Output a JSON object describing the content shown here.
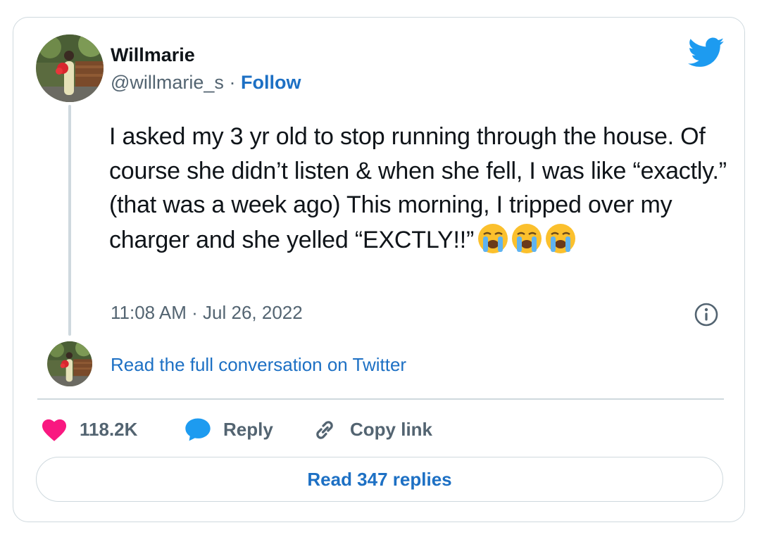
{
  "author": {
    "display_name": "Willmarie",
    "handle": "@willmarie_s",
    "separator": "·",
    "follow_label": "Follow"
  },
  "tweet": {
    "text": "I asked my 3 yr old to stop running through the house. Of course she didn’t listen & when she fell, I was like “exactly.” (that was a week ago) This morning, I tripped over my charger and she yelled “EXCTLY!!”",
    "emoji": [
      "loudly-crying-face-emoji",
      "loudly-crying-face-emoji",
      "loudly-crying-face-emoji"
    ],
    "timestamp": "11:08 AM · Jul 26, 2022"
  },
  "conversation": {
    "link_label": "Read the full conversation on Twitter"
  },
  "actions": {
    "like_count": "118.2K",
    "reply_label": "Reply",
    "copy_link_label": "Copy link"
  },
  "footer": {
    "read_replies_label": "Read 347 replies"
  },
  "colors": {
    "twitter_blue": "#1d9bf0",
    "link_blue": "#1d70c4",
    "like_pink": "#f91880",
    "secondary_text": "#536471",
    "border": "#cfd9de"
  },
  "icons": {
    "brand": "twitter-bird-icon",
    "info": "info-icon",
    "like": "heart-icon",
    "reply": "speech-bubble-icon",
    "copy": "link-icon"
  }
}
